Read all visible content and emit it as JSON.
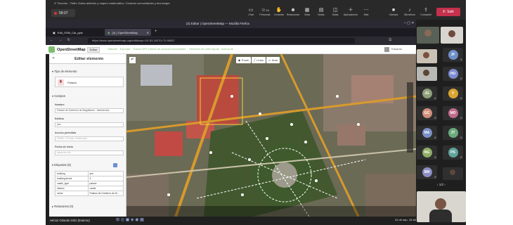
{
  "meeting": {
    "title": "4° Sección - Taller: Datos abiertos y mapeo colaborativo: Creando comunidades y tecnología",
    "timer": "58:07",
    "toolbar": [
      {
        "icon": "chat-icon",
        "label": "Chat"
      },
      {
        "icon": "people-icon",
        "label": "Personas"
      },
      {
        "icon": "raise-hand-icon",
        "label": "Levantar"
      },
      {
        "icon": "react-icon",
        "label": "Reaccionar"
      },
      {
        "icon": "view-icon",
        "label": "Vista"
      },
      {
        "icon": "notes-icon",
        "label": "Notas"
      },
      {
        "icon": "rooms-icon",
        "label": "Salas"
      },
      {
        "icon": "apps-icon",
        "label": "Aplicaciones"
      },
      {
        "icon": "more-icon",
        "label": "Más"
      },
      {
        "icon": "camera-icon",
        "label": "Cámara"
      },
      {
        "icon": "mic-icon",
        "label": "Micrófono"
      },
      {
        "icon": "share-icon",
        "label": "Compartir"
      }
    ],
    "leave_label": "Salir",
    "people_badge": "24"
  },
  "browser": {
    "window_title": "(2) Editar | OpenStreetMap — Mozilla Firefox",
    "tabs": [
      {
        "label": "Edit_OSM_Cal_pptx"
      },
      {
        "label": "(2) | OpenStreetMap"
      }
    ],
    "url": "https://www.openstreetmap.org/edit#map=19/-53.16270/-70.90837"
  },
  "osm": {
    "brand": "OpenStreetMap",
    "edit_label": "Editar",
    "nav": [
      "Historial",
      "Exportar",
      "Trazas GPS",
      "Diarios de usuario",
      "Comunidades",
      "Derechos de autor",
      "Ayuda",
      "Acerca de"
    ],
    "user": "Eduardo",
    "sidebar": {
      "title": "Editar elemento",
      "section_type": "Tipo de elemento",
      "preset": "Palacio",
      "section_fields": "Campos",
      "fields": [
        {
          "label": "Nombre",
          "value": "Palacio de Gobierno de Magallanes - Intendencia"
        },
        {
          "label": "Edificio",
          "value": "yes"
        },
        {
          "label": "Acceso permitido",
          "value": "Público, Privado, Reservado",
          "placeholder": true
        },
        {
          "label": "Fecha de inicio",
          "value": "aaaa-mm-dd",
          "placeholder": true
        }
      ],
      "section_tags": "Etiquetas (5)",
      "tags": [
        {
          "key": "building",
          "value": "yes"
        },
        {
          "key": "building:levels",
          "value": "3"
        },
        {
          "key": "castle_type",
          "value": "palace"
        },
        {
          "key": "historic",
          "value": "castle"
        },
        {
          "key": "name",
          "value": "Palacio de Gobierno de M..."
        }
      ],
      "section_relations": "Relaciones (0)"
    },
    "map_tools": [
      {
        "icon": "point-icon",
        "label": "Punto"
      },
      {
        "icon": "line-icon",
        "label": "Línea"
      },
      {
        "icon": "area-icon",
        "label": "Área"
      }
    ]
  },
  "taskbar": {
    "self_name": "Héctor Orlando Ortiz (Externo)",
    "time": "15:48",
    "date": "24 de sep."
  },
  "participants": [
    {
      "initials": "JF",
      "color": "#6f8fc8"
    },
    {
      "initials": "HU",
      "color": "#7d8bd0"
    },
    {
      "initials": "JG",
      "color": "#8fa07a"
    },
    {
      "initials": "V",
      "color": "#d9a531"
    },
    {
      "initials": "GC",
      "color": "#d18f7c"
    },
    {
      "initials": "MO",
      "color": "#c06b8c"
    },
    {
      "initials": "MA",
      "color": "#7a90c4"
    },
    {
      "initials": "JT",
      "color": "#6aaa7c"
    },
    {
      "initials": "NG",
      "color": "#8fae66"
    },
    {
      "initials": "PS",
      "color": "#5fa39c"
    },
    {
      "initials": "BM",
      "color": "#8d8dc2"
    }
  ],
  "pager": "1/2"
}
